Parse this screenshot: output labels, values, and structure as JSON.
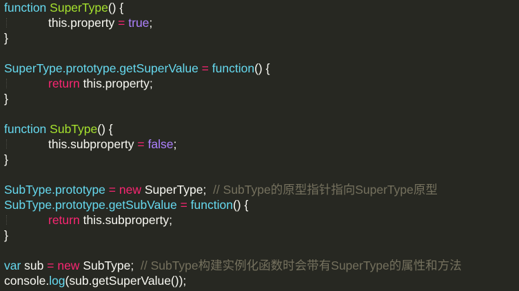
{
  "editor": {
    "lines": [
      {
        "tokens": [
          {
            "t": "function",
            "c": "kw"
          },
          {
            "t": " ",
            "c": "tx"
          },
          {
            "t": "SuperType",
            "c": "fn"
          },
          {
            "t": "() {",
            "c": "tx"
          }
        ]
      },
      {
        "tokens": [
          {
            "t": "this.property",
            "c": "tx"
          },
          {
            "t": " = ",
            "c": "ctl"
          },
          {
            "t": "true",
            "c": "bool"
          },
          {
            "t": ";",
            "c": "tx"
          }
        ]
      },
      {
        "tokens": [
          {
            "t": "}",
            "c": "tx"
          }
        ]
      },
      {
        "tokens": []
      },
      {
        "tokens": [
          {
            "t": "SuperType.prototype.getSuperValue",
            "c": "kw"
          },
          {
            "t": " = ",
            "c": "ctl"
          },
          {
            "t": "function",
            "c": "kw"
          },
          {
            "t": "() {",
            "c": "tx"
          }
        ]
      },
      {
        "tokens": [
          {
            "t": "return",
            "c": "ctl"
          },
          {
            "t": " this.property;",
            "c": "tx"
          }
        ]
      },
      {
        "tokens": [
          {
            "t": "}",
            "c": "tx"
          }
        ]
      },
      {
        "tokens": []
      },
      {
        "tokens": [
          {
            "t": "function",
            "c": "kw"
          },
          {
            "t": " ",
            "c": "tx"
          },
          {
            "t": "SubType",
            "c": "fn"
          },
          {
            "t": "() {",
            "c": "tx"
          }
        ]
      },
      {
        "tokens": [
          {
            "t": "this.subproperty",
            "c": "tx"
          },
          {
            "t": " = ",
            "c": "ctl"
          },
          {
            "t": "false",
            "c": "bool"
          },
          {
            "t": ";",
            "c": "tx"
          }
        ]
      },
      {
        "tokens": [
          {
            "t": "}",
            "c": "tx"
          }
        ]
      },
      {
        "tokens": []
      },
      {
        "tokens": [
          {
            "t": "SubType.prototype",
            "c": "kw"
          },
          {
            "t": " = ",
            "c": "ctl"
          },
          {
            "t": "new",
            "c": "ctl"
          },
          {
            "t": " SuperType;  ",
            "c": "tx"
          },
          {
            "t": "// SubType的原型指针指向SuperType原型",
            "c": "cm"
          }
        ]
      },
      {
        "tokens": [
          {
            "t": "SubType.prototype.getSubValue",
            "c": "kw"
          },
          {
            "t": " = ",
            "c": "ctl"
          },
          {
            "t": "function",
            "c": "kw"
          },
          {
            "t": "() {",
            "c": "tx"
          }
        ]
      },
      {
        "tokens": [
          {
            "t": "return",
            "c": "ctl"
          },
          {
            "t": " this.subproperty;",
            "c": "tx"
          }
        ]
      },
      {
        "tokens": [
          {
            "t": "}",
            "c": "tx"
          }
        ]
      },
      {
        "tokens": []
      },
      {
        "tokens": [
          {
            "t": "var",
            "c": "kw"
          },
          {
            "t": " sub",
            "c": "tx"
          },
          {
            "t": " = ",
            "c": "ctl"
          },
          {
            "t": "new",
            "c": "ctl"
          },
          {
            "t": " SubType;  ",
            "c": "tx"
          },
          {
            "t": "// SubType构建实例化函数时会带有SuperType的属性和方法",
            "c": "cm"
          }
        ]
      },
      {
        "tokens": [
          {
            "t": "console.",
            "c": "tx"
          },
          {
            "t": "log",
            "c": "kw"
          },
          {
            "t": "(sub.getSuperValue());",
            "c": "tx"
          }
        ]
      }
    ]
  },
  "colors": {
    "background": "#272822",
    "keyword_blue": "#66d9ef",
    "operator_pink": "#f92672",
    "function_green": "#a6e22e",
    "boolean_purple": "#ae81ff",
    "comment_gray": "#75715e",
    "text": "#f8f8f2"
  }
}
